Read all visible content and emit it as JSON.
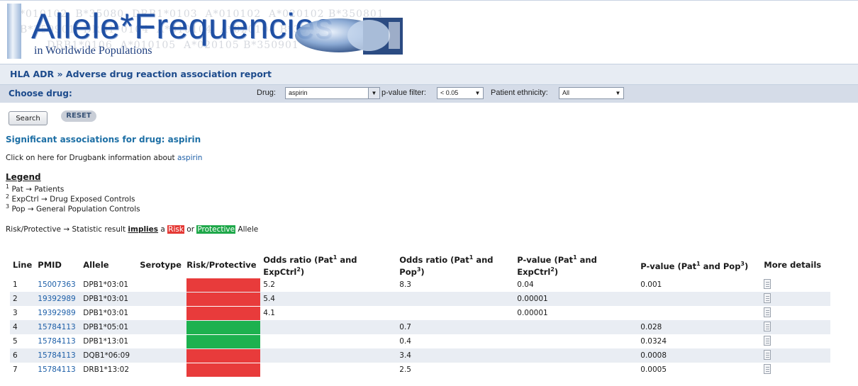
{
  "banner": {
    "title": "Allele*Frequencies",
    "subtitle": "in Worldwide Populations",
    "background_text": "*010102  B*35080  DRB1*0103  A*010102  A*020102 B*350801\nB*350901  DRB1*0104  A*010104  A*020104 B*35090\n       DRB1*0106  A*010105  A*020105 B*350901"
  },
  "breadcrumb": "HLA ADR » Adverse drug reaction association report",
  "filters": {
    "choose_label": "Choose drug:",
    "drug_label": "Drug:",
    "drug_value": "aspirin",
    "pvalue_label": "p-value filter:",
    "pvalue_value": "< 0.05",
    "ethnicity_label": "Patient ethnicity:",
    "ethnicity_value": "All",
    "search_label": "Search",
    "reset_label": "RESET"
  },
  "results_heading": "Significant associations for drug: aspirin",
  "drugbank": {
    "prefix": "Click on here for Drugbank information about ",
    "link": "aspirin"
  },
  "legend": {
    "title": "Legend",
    "items": [
      {
        "num": "1",
        "text": "Pat → Patients"
      },
      {
        "num": "2",
        "text": "ExpCtrl → Drug Exposed Controls"
      },
      {
        "num": "3",
        "text": "Pop → General Population Controls"
      }
    ],
    "note_prefix": "Risk/Protective → Statistic result ",
    "note_implies": "implies",
    "note_a": " a ",
    "risk": "Risk",
    "or": " or ",
    "protective": "Protective",
    "allele": " Allele"
  },
  "table": {
    "headers": {
      "line": "Line",
      "pmid": "PMID",
      "allele": "Allele",
      "serotype": "Serotype",
      "risk_protective": "Risk/Protective",
      "or_exp": "Odds ratio (Pat",
      "or_exp_mid": " and ExpCtrl",
      "or_pop": "Odds ratio (Pat",
      "or_pop_mid": " and Pop",
      "pv_exp": "P-value (Pat",
      "pv_exp_mid": " and ExpCtrl",
      "pv_pop": "P-value (Pat",
      "pv_pop_mid": " and Pop",
      "more": "More details",
      "sup1": "1",
      "sup2": "2",
      "sup3": "3"
    },
    "rows": [
      {
        "line": "1",
        "pmid": "15007363",
        "allele": "DPB1*03:01",
        "serotype": "",
        "type": "risk",
        "or_exp": "5.2",
        "or_pop": "8.3",
        "pv_exp": "0.04",
        "pv_pop": "0.001"
      },
      {
        "line": "2",
        "pmid": "19392989",
        "allele": "DPB1*03:01",
        "serotype": "",
        "type": "risk",
        "or_exp": "5.4",
        "or_pop": "",
        "pv_exp": "0.00001",
        "pv_pop": ""
      },
      {
        "line": "3",
        "pmid": "19392989",
        "allele": "DPB1*03:01",
        "serotype": "",
        "type": "risk",
        "or_exp": "4.1",
        "or_pop": "",
        "pv_exp": "0.00001",
        "pv_pop": ""
      },
      {
        "line": "4",
        "pmid": "15784113",
        "allele": "DPB1*05:01",
        "serotype": "",
        "type": "protective",
        "or_exp": "",
        "or_pop": "0.7",
        "pv_exp": "",
        "pv_pop": "0.028"
      },
      {
        "line": "5",
        "pmid": "15784113",
        "allele": "DPB1*13:01",
        "serotype": "",
        "type": "protective",
        "or_exp": "",
        "or_pop": "0.4",
        "pv_exp": "",
        "pv_pop": "0.0324"
      },
      {
        "line": "6",
        "pmid": "15784113",
        "allele": "DQB1*06:09",
        "serotype": "",
        "type": "risk",
        "or_exp": "",
        "or_pop": "3.4",
        "pv_exp": "",
        "pv_pop": "0.0008"
      },
      {
        "line": "7",
        "pmid": "15784113",
        "allele": "DRB1*13:02",
        "serotype": "",
        "type": "risk",
        "or_exp": "",
        "or_pop": "2.5",
        "pv_exp": "",
        "pv_pop": "0.0005"
      }
    ]
  },
  "colors": {
    "risk": "#e83b3b",
    "protective": "#1db14f",
    "link": "#1d5fa8",
    "heading": "#1d4b8c"
  }
}
